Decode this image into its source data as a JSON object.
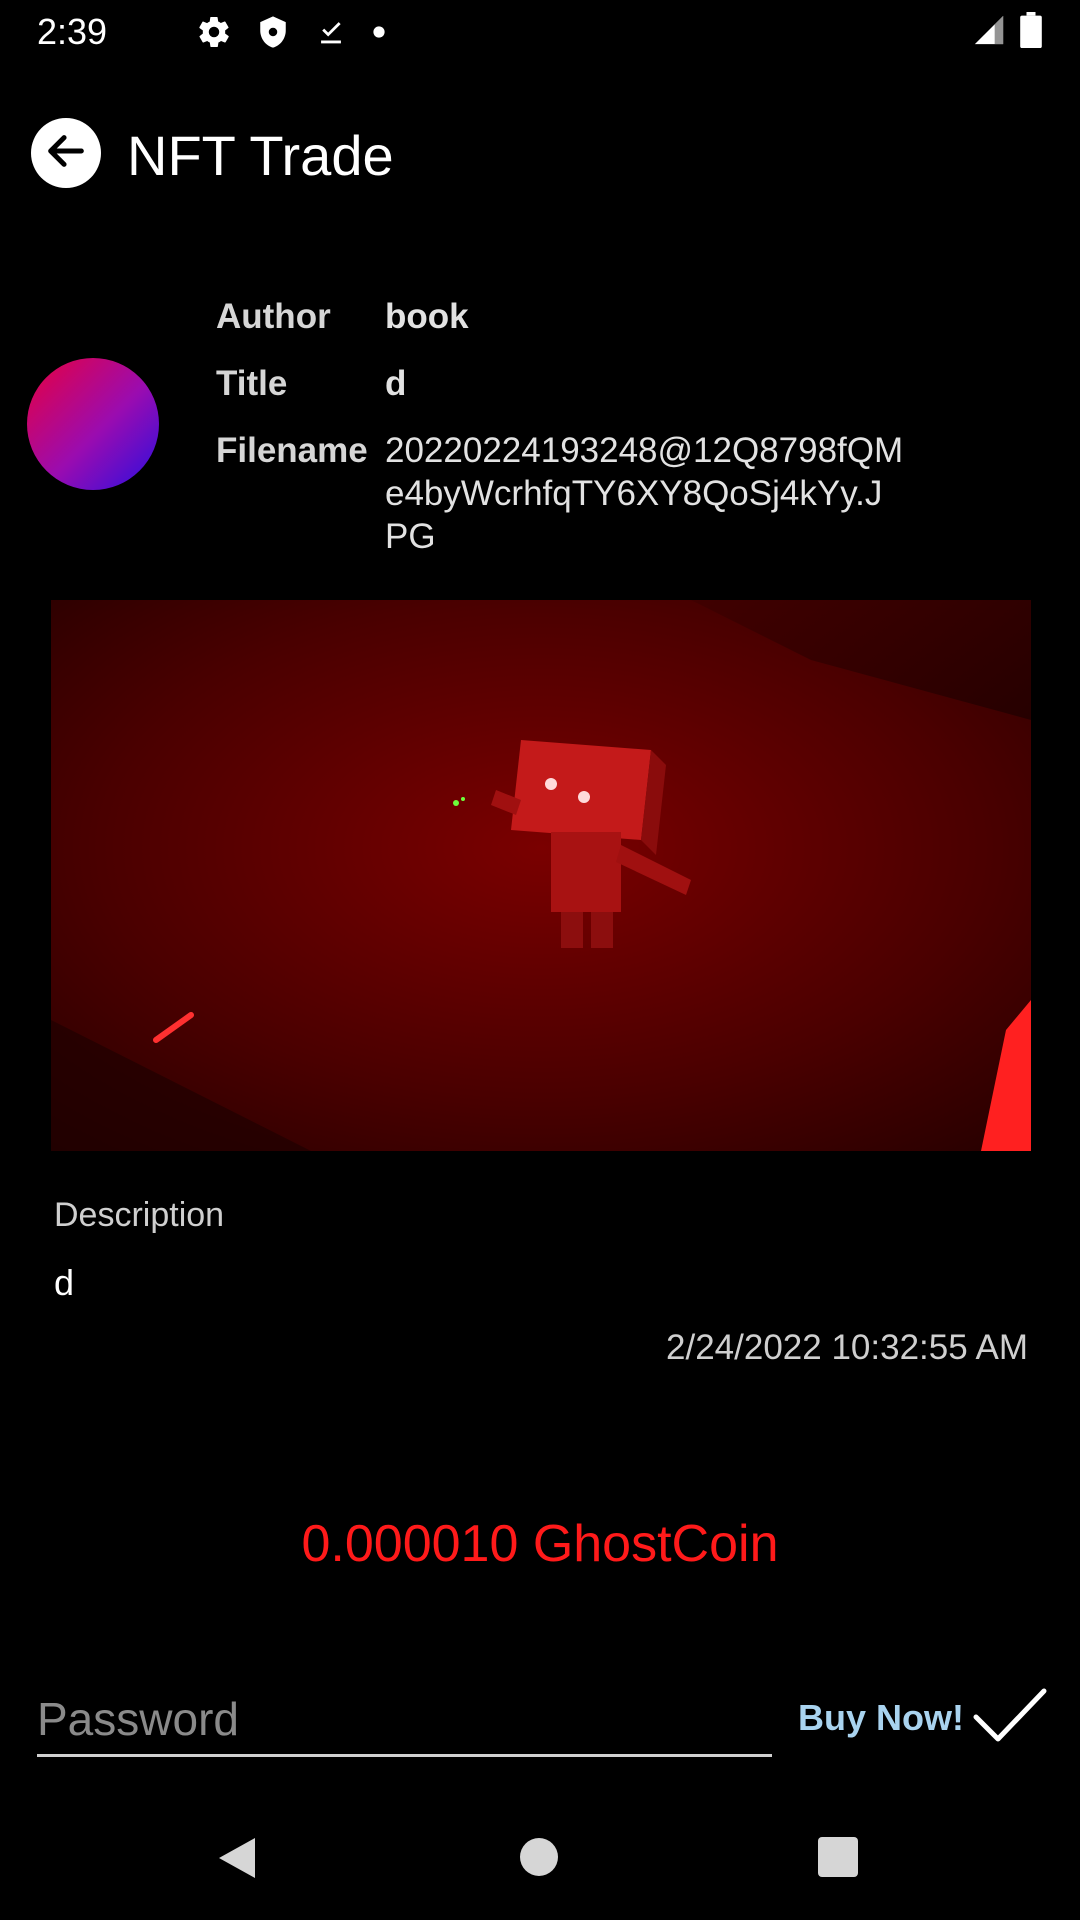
{
  "status_bar": {
    "time": "2:39",
    "icons": [
      "gear-icon",
      "shield-icon",
      "download-done-icon",
      "dot-icon",
      "signal-icon",
      "battery-icon"
    ]
  },
  "app_bar": {
    "title": "NFT Trade",
    "back_icon": "arrow-left-icon"
  },
  "meta": {
    "author_label": "Author",
    "author_value": "book",
    "title_label": "Title",
    "title_value": "d",
    "filename_label": "Filename",
    "filename_value": "20220224193248@12Q8798fQMe4byWcrhfqTY6XY8QoSj4kYy.JPG"
  },
  "description": {
    "label": "Description",
    "value": "d",
    "timestamp": "2/24/2022 10:32:55 AM"
  },
  "price": "0.000010 GhostCoin",
  "purchase": {
    "password_placeholder": "Password",
    "buy_label": "Buy Now!"
  },
  "colors": {
    "price": "#ff1a1a",
    "buy_label": "#a9d3ef",
    "background": "#000000"
  }
}
